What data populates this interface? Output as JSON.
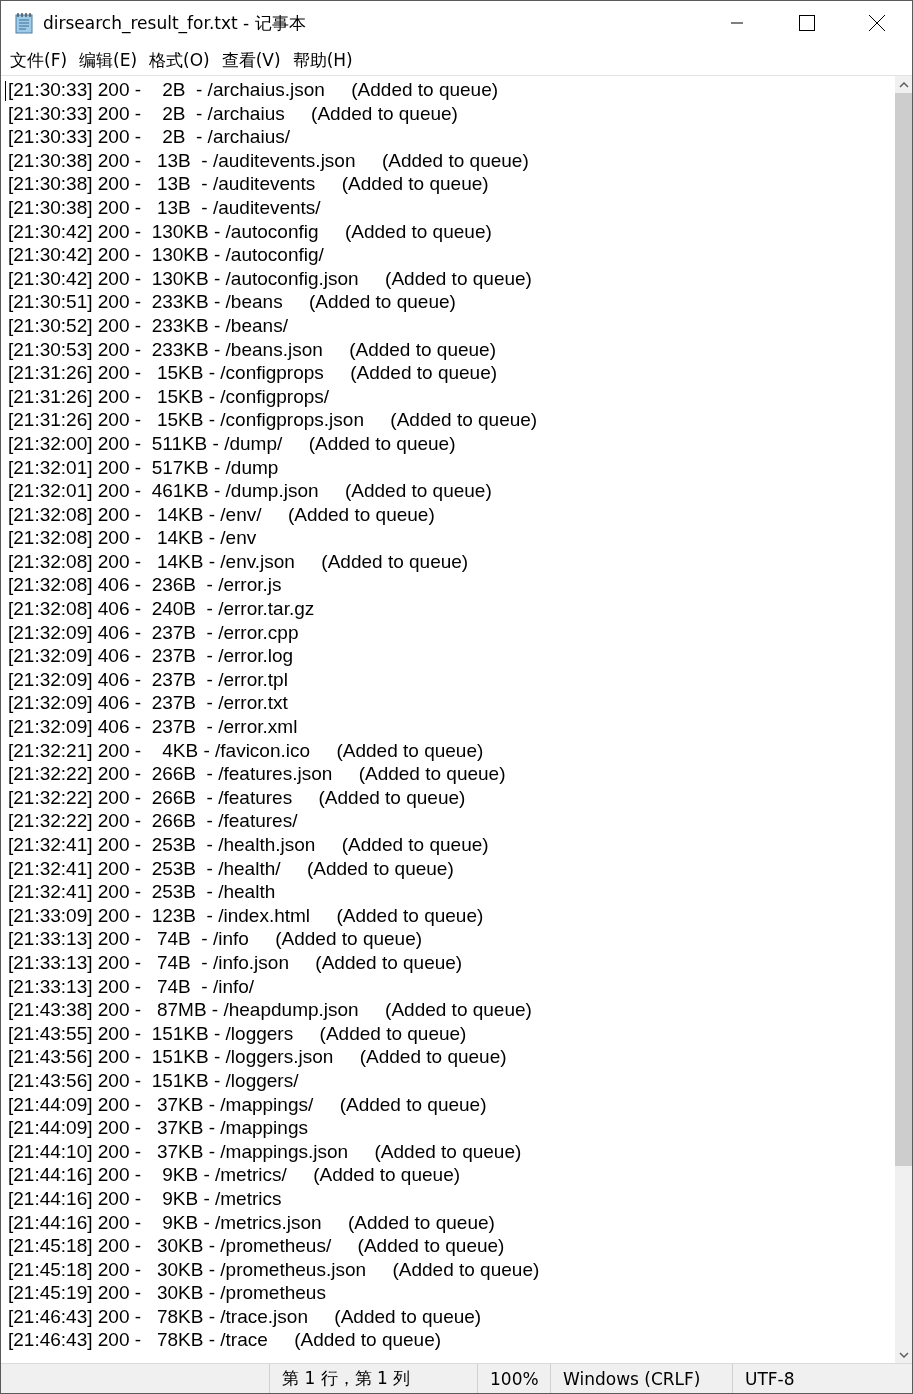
{
  "window": {
    "title": "dirsearch_result_for.txt - 记事本"
  },
  "menu": [
    "文件(F)",
    "编辑(E)",
    "格式(O)",
    "查看(V)",
    "帮助(H)"
  ],
  "lines": [
    "[21:30:33] 200 -    2B  - /archaius.json     (Added to queue)",
    "[21:30:33] 200 -    2B  - /archaius     (Added to queue)",
    "[21:30:33] 200 -    2B  - /archaius/",
    "[21:30:38] 200 -   13B  - /auditevents.json     (Added to queue)",
    "[21:30:38] 200 -   13B  - /auditevents     (Added to queue)",
    "[21:30:38] 200 -   13B  - /auditevents/",
    "[21:30:42] 200 -  130KB - /autoconfig     (Added to queue)",
    "[21:30:42] 200 -  130KB - /autoconfig/",
    "[21:30:42] 200 -  130KB - /autoconfig.json     (Added to queue)",
    "[21:30:51] 200 -  233KB - /beans     (Added to queue)",
    "[21:30:52] 200 -  233KB - /beans/",
    "[21:30:53] 200 -  233KB - /beans.json     (Added to queue)",
    "[21:31:26] 200 -   15KB - /configprops     (Added to queue)",
    "[21:31:26] 200 -   15KB - /configprops/",
    "[21:31:26] 200 -   15KB - /configprops.json     (Added to queue)",
    "[21:32:00] 200 -  511KB - /dump/     (Added to queue)",
    "[21:32:01] 200 -  517KB - /dump",
    "[21:32:01] 200 -  461KB - /dump.json     (Added to queue)",
    "[21:32:08] 200 -   14KB - /env/     (Added to queue)",
    "[21:32:08] 200 -   14KB - /env",
    "[21:32:08] 200 -   14KB - /env.json     (Added to queue)",
    "[21:32:08] 406 -  236B  - /error.js",
    "[21:32:08] 406 -  240B  - /error.tar.gz",
    "[21:32:09] 406 -  237B  - /error.cpp",
    "[21:32:09] 406 -  237B  - /error.log",
    "[21:32:09] 406 -  237B  - /error.tpl",
    "[21:32:09] 406 -  237B  - /error.txt",
    "[21:32:09] 406 -  237B  - /error.xml",
    "[21:32:21] 200 -    4KB - /favicon.ico     (Added to queue)",
    "[21:32:22] 200 -  266B  - /features.json     (Added to queue)",
    "[21:32:22] 200 -  266B  - /features     (Added to queue)",
    "[21:32:22] 200 -  266B  - /features/",
    "[21:32:41] 200 -  253B  - /health.json     (Added to queue)",
    "[21:32:41] 200 -  253B  - /health/     (Added to queue)",
    "[21:32:41] 200 -  253B  - /health",
    "[21:33:09] 200 -  123B  - /index.html     (Added to queue)",
    "[21:33:13] 200 -   74B  - /info     (Added to queue)",
    "[21:33:13] 200 -   74B  - /info.json     (Added to queue)",
    "[21:33:13] 200 -   74B  - /info/",
    "[21:43:38] 200 -   87MB - /heapdump.json     (Added to queue)",
    "[21:43:55] 200 -  151KB - /loggers     (Added to queue)",
    "[21:43:56] 200 -  151KB - /loggers.json     (Added to queue)",
    "[21:43:56] 200 -  151KB - /loggers/",
    "[21:44:09] 200 -   37KB - /mappings/     (Added to queue)",
    "[21:44:09] 200 -   37KB - /mappings",
    "[21:44:10] 200 -   37KB - /mappings.json     (Added to queue)",
    "[21:44:16] 200 -    9KB - /metrics/     (Added to queue)",
    "[21:44:16] 200 -    9KB - /metrics",
    "[21:44:16] 200 -    9KB - /metrics.json     (Added to queue)",
    "[21:45:18] 200 -   30KB - /prometheus/     (Added to queue)",
    "[21:45:18] 200 -   30KB - /prometheus.json     (Added to queue)",
    "[21:45:19] 200 -   30KB - /prometheus",
    "[21:46:43] 200 -   78KB - /trace.json     (Added to queue)",
    "[21:46:43] 200 -   78KB - /trace     (Added to queue)"
  ],
  "status_bar": {
    "position": "第 1 行，第 1 列",
    "zoom": "100%",
    "line_ending": "Windows (CRLF)",
    "encoding": "UTF-8"
  }
}
